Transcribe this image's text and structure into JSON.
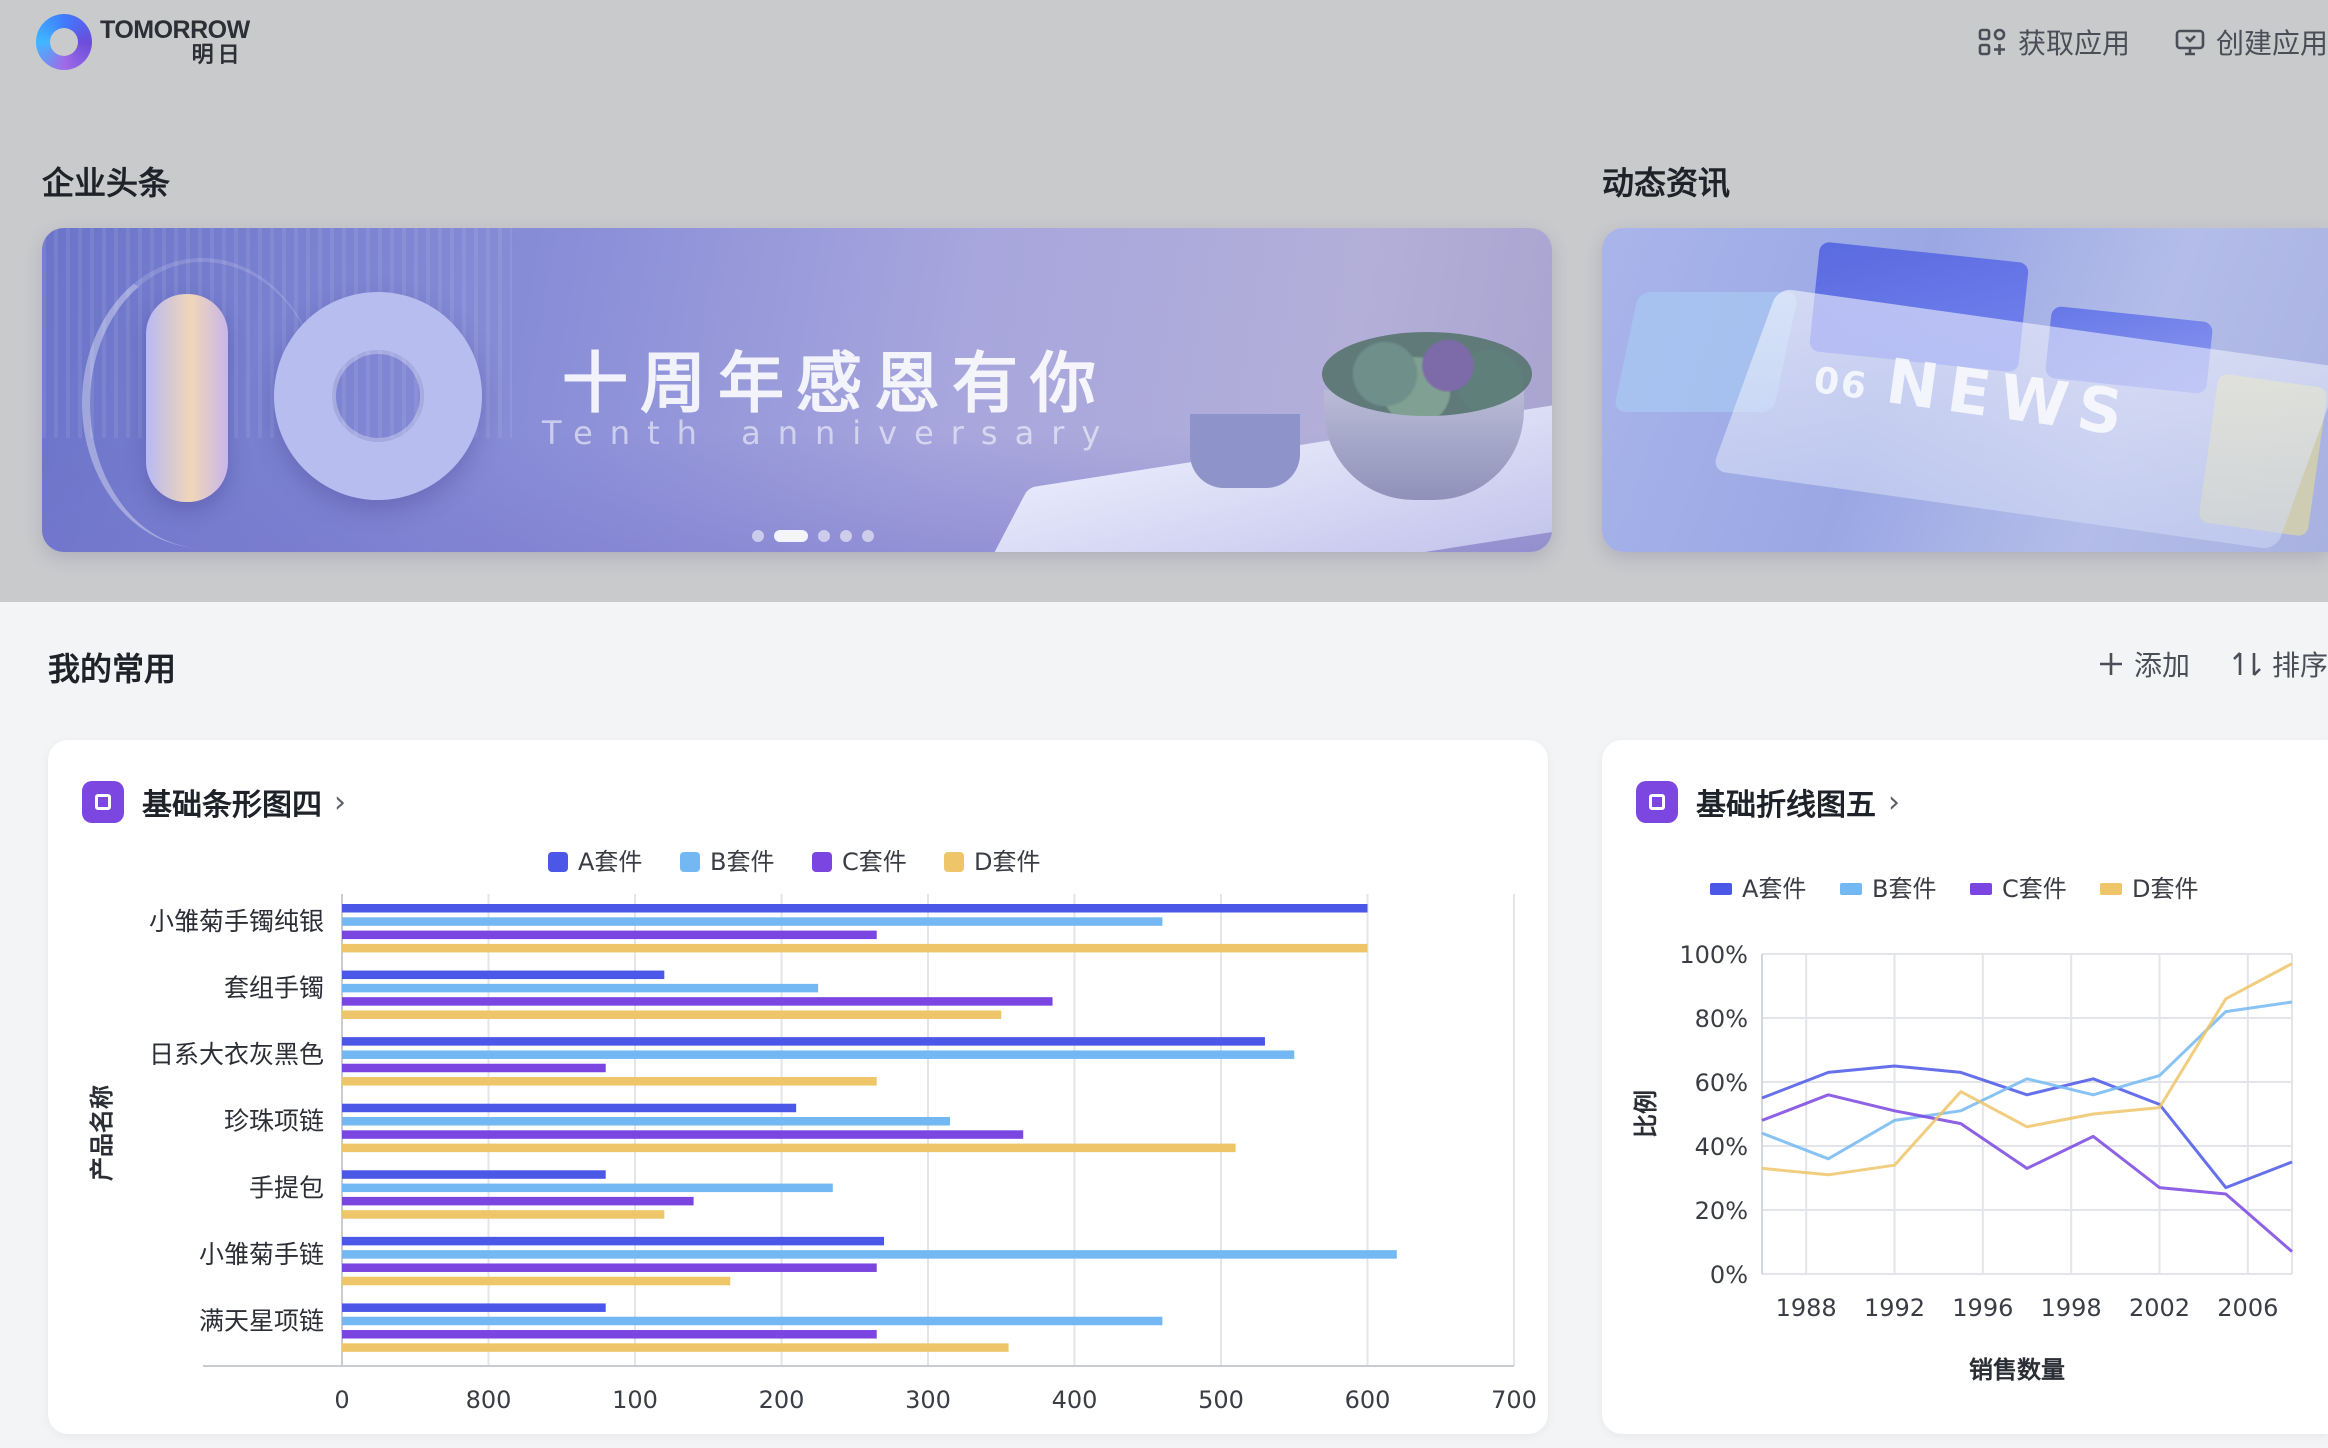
{
  "brand": {
    "name_en": "TOMORROW",
    "name_cn": "明日"
  },
  "top_actions": {
    "get_app": "获取应用",
    "create_app": "创建应用"
  },
  "sections": {
    "headlines": "企业头条",
    "news": "动态资讯",
    "common": "我的常用"
  },
  "banner": {
    "title": "十周年感恩有你",
    "subtitle": "Tenth anniversary",
    "big_number": "10",
    "slides": 5,
    "active_slide": 1
  },
  "news_card": {
    "issue": "06",
    "word": "NEWS"
  },
  "common_actions": {
    "add": "添加",
    "sort": "排序"
  },
  "colors": {
    "A": "#4b57e6",
    "B": "#73b8f2",
    "C": "#7a45e0",
    "D": "#eec569",
    "accent": "#7b47e0"
  },
  "bar_card": {
    "title": "基础条形图四"
  },
  "line_card": {
    "title": "基础折线图五"
  },
  "chart_data": [
    {
      "type": "bar",
      "orientation": "horizontal",
      "ylabel": "产品名称",
      "categories": [
        "小雏菊手镯纯银",
        "套组手镯",
        "日系大衣灰黑色",
        "珍珠项链",
        "手提包",
        "小雏菊手链",
        "满天星项链"
      ],
      "x_tick_labels": [
        "0",
        "800",
        "100",
        "200",
        "300",
        "400",
        "500",
        "600",
        "700"
      ],
      "xlim": [
        0,
        800
      ],
      "legend": "top",
      "grid": true,
      "series": [
        {
          "name": "A套件",
          "values": [
            700,
            220,
            630,
            310,
            180,
            370,
            180
          ]
        },
        {
          "name": "B套件",
          "values": [
            560,
            325,
            650,
            415,
            335,
            720,
            560
          ]
        },
        {
          "name": "C套件",
          "values": [
            365,
            485,
            180,
            465,
            240,
            365,
            365
          ]
        },
        {
          "name": "D套件",
          "values": [
            700,
            450,
            365,
            610,
            220,
            265,
            455
          ]
        }
      ]
    },
    {
      "type": "line",
      "xlabel": "销售数量",
      "ylabel": "比例",
      "x_tick_labels": [
        "1988",
        "1992",
        "1996",
        "1998",
        "2002",
        "2006"
      ],
      "y_tick_labels": [
        "0%",
        "20%",
        "40%",
        "60%",
        "80%",
        "100%"
      ],
      "ylim": [
        0,
        100
      ],
      "legend": "top",
      "grid": true,
      "series": [
        {
          "name": "A套件",
          "values": [
            55,
            63,
            65,
            63,
            56,
            61,
            53,
            27,
            35
          ]
        },
        {
          "name": "B套件",
          "values": [
            44,
            36,
            48,
            51,
            61,
            56,
            62,
            82,
            85
          ]
        },
        {
          "name": "C套件",
          "values": [
            48,
            56,
            51,
            47,
            33,
            43,
            27,
            25,
            7
          ]
        },
        {
          "name": "D套件",
          "values": [
            33,
            31,
            34,
            57,
            46,
            50,
            52,
            86,
            97
          ]
        }
      ]
    }
  ]
}
